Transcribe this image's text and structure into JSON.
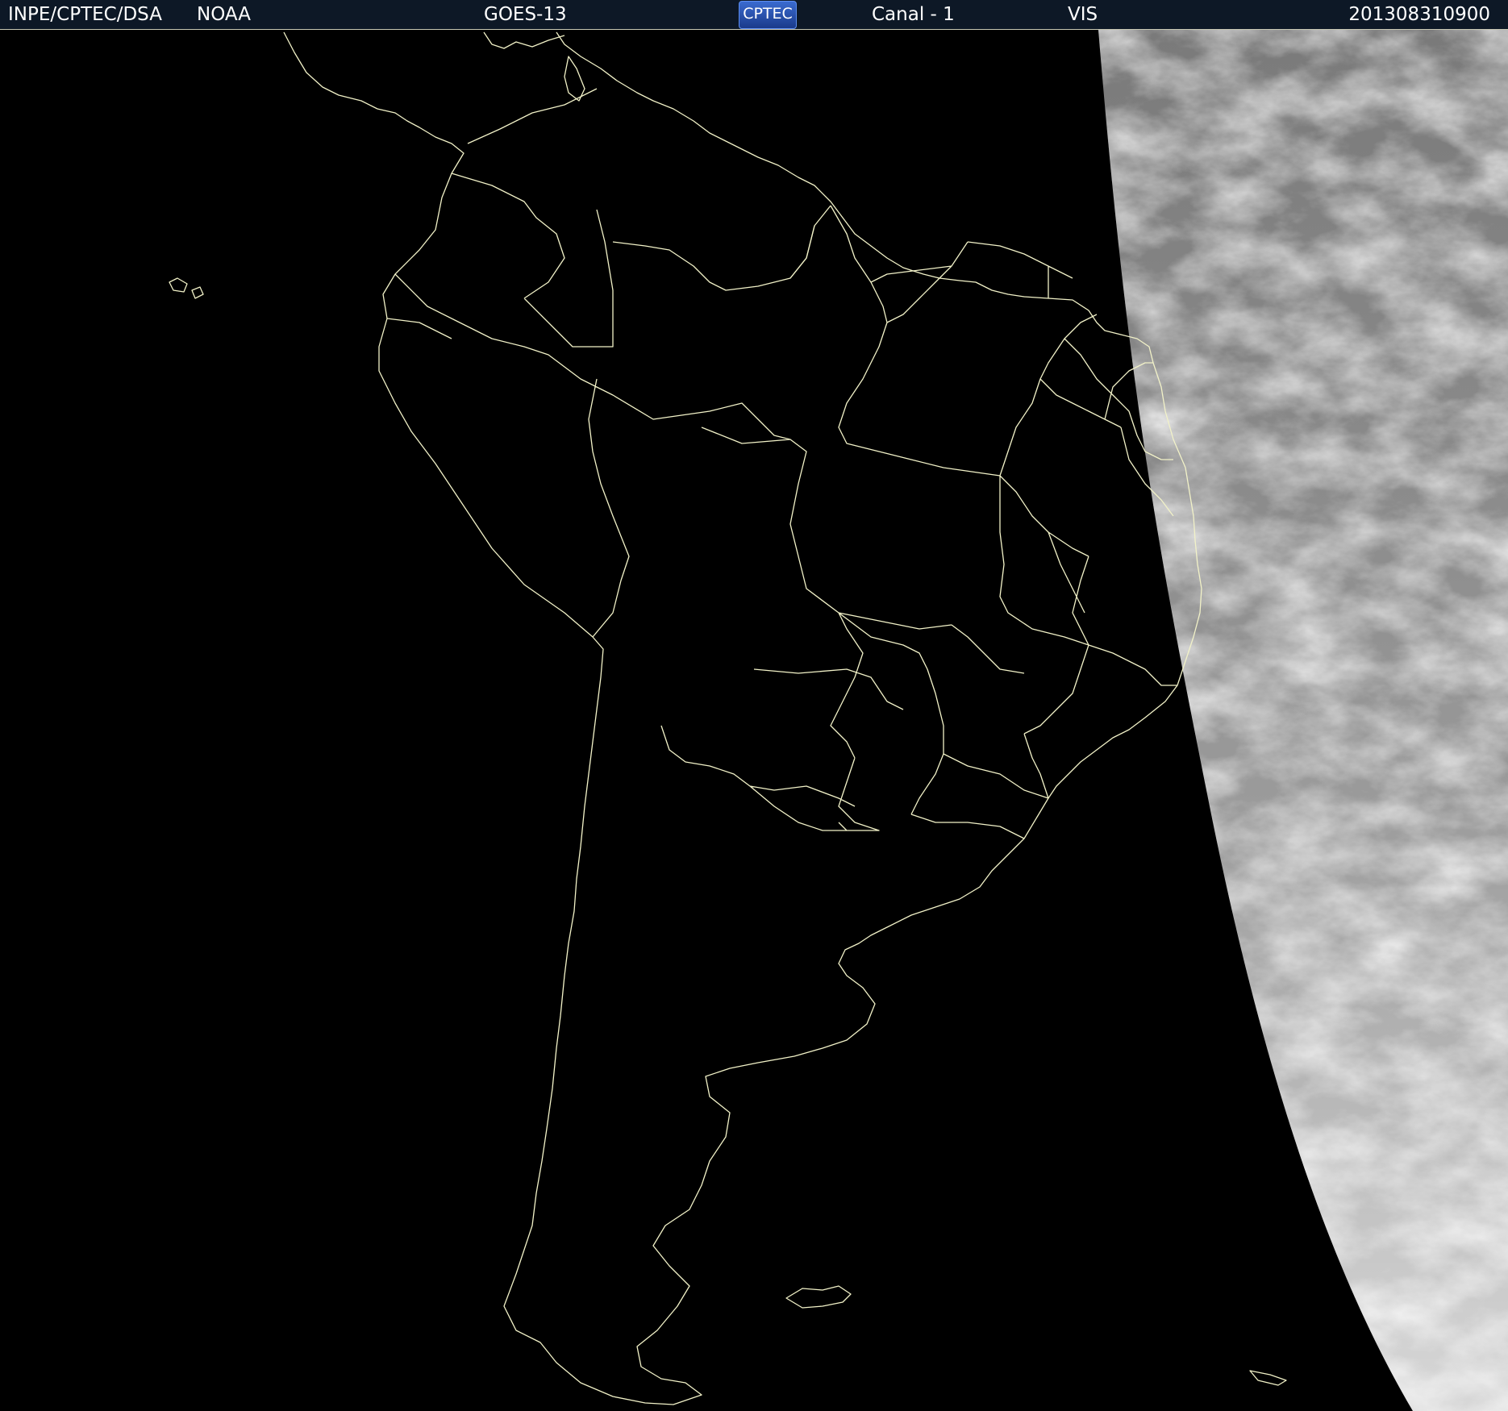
{
  "header": {
    "source": "INPE/CPTEC/DSA",
    "agency": "NOAA",
    "satellite": "GOES-13",
    "logo_text": "CPTEC",
    "channel": "Canal - 1",
    "band": "VIS",
    "timestamp": "201308310900"
  },
  "colors": {
    "header_background": "#0d1826",
    "header_text": "#ffffff",
    "space": "#000000",
    "coastline": "#f2f2c8",
    "cloud_bright": "#e8e8e8",
    "cloud_dark": "#6e6e6e"
  },
  "map": {
    "image_type": "visible satellite image, night side black, terminator on east",
    "region": "South America",
    "overlay": "coastline and state/country borders"
  }
}
